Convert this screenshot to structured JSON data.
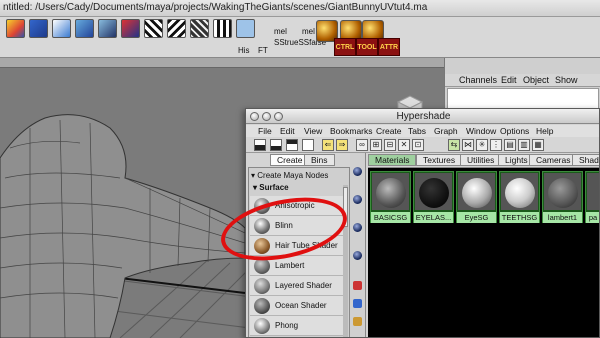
{
  "title_bar": {
    "path": "ntitled: /Users/Cady/Documents/maya/projects/WakingTheGiants/scenes/GiantBunnyUVtut4.ma"
  },
  "shelf": {
    "labels": [
      "His",
      "FT",
      "mel",
      "SStrueSSfalse",
      "mel"
    ],
    "tiles": [
      "CTRL",
      "TOOL",
      "ATTR"
    ]
  },
  "channel_box": {
    "menu": [
      "Channels",
      "Edit",
      "Object",
      "Show"
    ]
  },
  "hypershade": {
    "title": "Hypershade",
    "menu": [
      "File",
      "Edit",
      "View",
      "Bookmarks",
      "Create",
      "Tabs",
      "Graph",
      "Window",
      "Options",
      "Help"
    ],
    "left_tabs": [
      "Create",
      "Bins"
    ],
    "create_header": "Create Maya Nodes",
    "section": "Surface",
    "nodes": [
      "Anisotropic",
      "Blinn",
      "Hair Tube Shader",
      "Lambert",
      "Layered Shader",
      "Ocean Shader",
      "Phong"
    ],
    "right_tabs": [
      "Materials",
      "Textures",
      "Utilities",
      "Lights",
      "Cameras",
      "Shadi"
    ],
    "swatches": [
      "BASICSG",
      "EYELAS...",
      "EyeSG",
      "TEETHSG",
      "lambert1",
      "pa"
    ]
  },
  "colors": {
    "annotation": "#e01010",
    "swatch_frame": "#1a5a1a"
  }
}
